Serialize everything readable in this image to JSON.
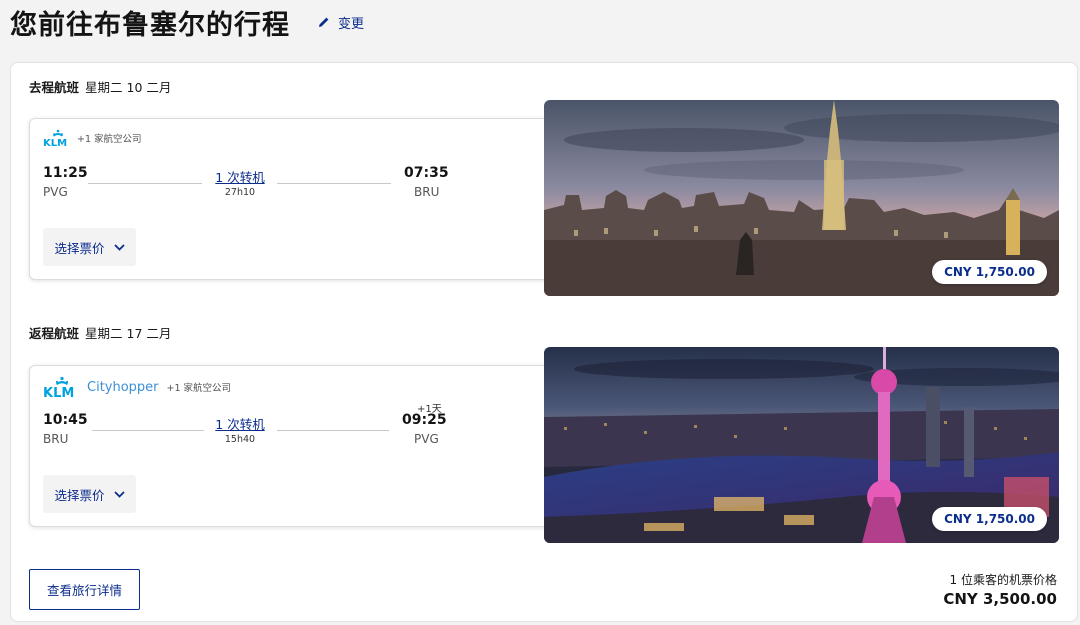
{
  "header": {
    "title": "您前往布鲁塞尔的行程",
    "edit_label": "变更"
  },
  "outbound": {
    "label": "去程航班",
    "date": "星期二 10 二月",
    "airline_logo_text": "KLM",
    "airline_extra": "+1 家航空公司",
    "depart_time": "11:25",
    "depart_code": "PVG",
    "stops": "1 次转机",
    "duration": "27h10",
    "arrive_time": "07:35",
    "arrive_code": "BRU",
    "fare_label": "选择票价",
    "price": "CNY 1,750.00"
  },
  "inbound": {
    "label": "返程航班",
    "date": "星期二 17 二月",
    "airline_logo_text": "KLM",
    "airline_sub": "Cityhopper",
    "airline_extra": "+1 家航空公司",
    "depart_time": "10:45",
    "depart_code": "BRU",
    "stops": "1 次转机",
    "duration": "15h40",
    "plus_day": "+1天",
    "arrive_time": "09:25",
    "arrive_code": "PVG",
    "fare_label": "选择票价",
    "price": "CNY 1,750.00"
  },
  "footer": {
    "details_label": "查看旅行详情",
    "total_label": "1 位乘客的机票价格",
    "total_price": "CNY 3,500.00"
  },
  "colors": {
    "brand_blue": "#0b2d8c",
    "klm_blue": "#00a1de"
  }
}
